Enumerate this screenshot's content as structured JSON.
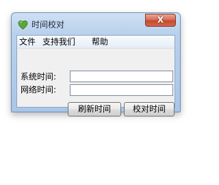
{
  "window": {
    "title": "时间校对",
    "close_label": "X"
  },
  "menubar": {
    "items": [
      {
        "label": "文件"
      },
      {
        "label": "支持我们"
      },
      {
        "label": "帮助"
      }
    ]
  },
  "form": {
    "system_time_label": "系统时间:",
    "system_time_value": "",
    "network_time_label": "网络时间:",
    "network_time_value": ""
  },
  "buttons": {
    "refresh_label": "刷新时间",
    "calibrate_label": "校对时间"
  },
  "colors": {
    "frame": "#b9d1ec",
    "close_button": "#c64a2e",
    "client_background": "#f0f0f0"
  },
  "icons": {
    "app": "heart-icon"
  }
}
